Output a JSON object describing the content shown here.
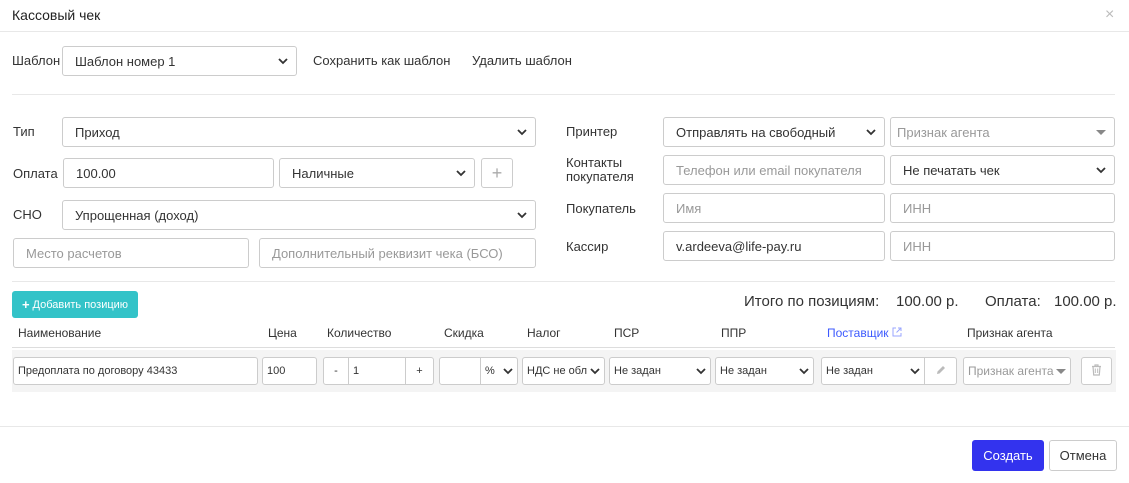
{
  "dialog": {
    "title": "Кассовый чек"
  },
  "template": {
    "label": "Шаблон",
    "selected": "Шаблон номер 1",
    "save_as": "Сохранить как шаблон",
    "delete": "Удалить шаблон"
  },
  "left": {
    "type_label": "Тип",
    "type_value": "Приход",
    "payment_label": "Оплата",
    "payment_amount": "100.00",
    "payment_method": "Наличные",
    "sno_label": "СНО",
    "sno_value": "Упрощенная (доход)",
    "place_placeholder": "Место расчетов",
    "extra_placeholder": "Дополнительный реквизит чека (БСО)"
  },
  "right": {
    "printer_label": "Принтер",
    "printer_value": "Отправлять на свободный",
    "agent_placeholder": "Признак агента",
    "contacts_label_1": "Контакты",
    "contacts_label_2": "покупателя",
    "contacts_placeholder": "Телефон или email покупателя",
    "print_option": "Не печатать чек",
    "buyer_label": "Покупатель",
    "buyer_name_placeholder": "Имя",
    "buyer_inn_placeholder": "ИНН",
    "cashier_label": "Кассир",
    "cashier_value": "v.ardeeva@life-pay.ru",
    "cashier_inn_placeholder": "ИНН"
  },
  "positions": {
    "add_button": "Добавить позицию",
    "total_label": "Итого по позициям:",
    "total_value": "100.00 р.",
    "payment_label": "Оплата:",
    "payment_value": "100.00 р.",
    "headers": {
      "name": "Наименование",
      "price": "Цена",
      "qty": "Количество",
      "discount": "Скидка",
      "tax": "Налог",
      "psr": "ПСР",
      "ppr": "ППР",
      "supplier": "Поставщик",
      "agent": "Признак агента"
    },
    "row": {
      "name": "Предоплата по договору 43433",
      "price": "100",
      "minus": "-",
      "qty": "1",
      "plus": "+",
      "discount_unit": "%",
      "tax": "НДС не обл",
      "psr": "Не задан",
      "ppr": "Не задан",
      "supplier": "Не задан",
      "agent_placeholder": "Признак агента"
    }
  },
  "footer": {
    "create": "Создать",
    "cancel": "Отмена"
  },
  "colors": {
    "accent": "#3333ee",
    "teal": "#33c3c8",
    "link": "#3d5afe"
  },
  "icons": [
    "close-icon",
    "chevron-down-icon",
    "plus-icon",
    "pencil-icon",
    "trash-icon",
    "external-link-icon"
  ]
}
